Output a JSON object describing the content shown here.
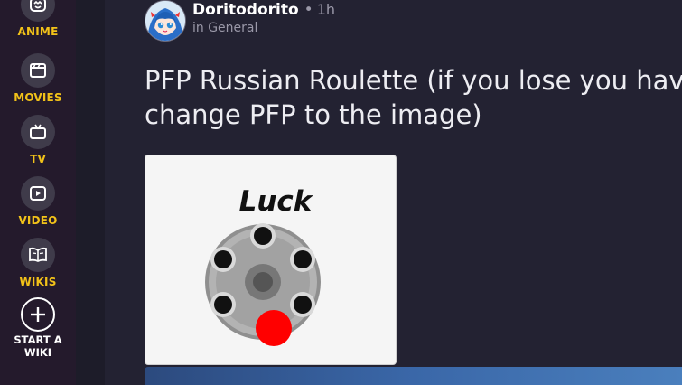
{
  "sidebar": {
    "items": [
      {
        "label": "ANIME",
        "icon": "anime-icon"
      },
      {
        "label": "MOVIES",
        "icon": "movie-icon"
      },
      {
        "label": "TV",
        "icon": "tv-icon"
      },
      {
        "label": "VIDEO",
        "icon": "video-icon"
      },
      {
        "label": "WIKIS",
        "icon": "book-icon"
      }
    ],
    "start_wiki": {
      "line1": "START A",
      "line2": "WIKI",
      "icon": "plus-icon"
    }
  },
  "post": {
    "author": "Doritodorito",
    "separator": "•",
    "time": "1h",
    "category": "in General",
    "title_line1": "PFP Russian Roulette (if you lose you hav",
    "title_line2": "change PFP to the image)",
    "image_text": "Luck"
  },
  "colors": {
    "accent": "#f2c219",
    "sidebar_bg": "#241a2c",
    "main_bg": "#232232",
    "chamber_red": "#ff0000"
  }
}
